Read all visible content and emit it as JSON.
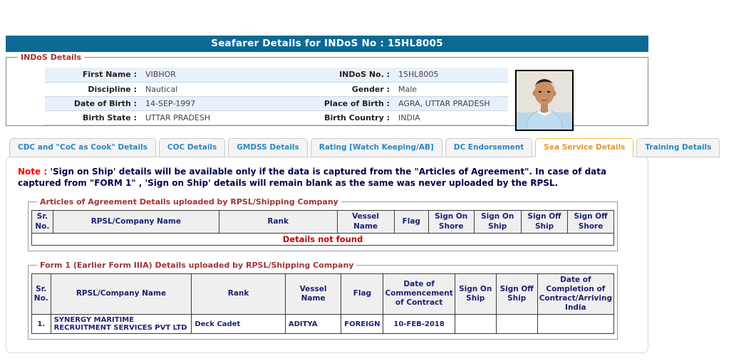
{
  "page": {
    "title": "Seafarer Details for INDoS No : 15HL8005"
  },
  "indos": {
    "legend": "INDoS Details",
    "rows": [
      {
        "l1": "First Name :",
        "v1": "VIBHOR",
        "l2": "INDoS No. :",
        "v2": "15HL8005"
      },
      {
        "l1": "Discipline :",
        "v1": "Nautical",
        "l2": "Gender :",
        "v2": "Male"
      },
      {
        "l1": "Date of Birth :",
        "v1": "14-SEP-1997",
        "l2": "Place of Birth :",
        "v2": "AGRA, UTTAR PRADESH"
      },
      {
        "l1": "Birth State :",
        "v1": "UTTAR PRADESH",
        "l2": "Birth Country :",
        "v2": "INDIA"
      }
    ]
  },
  "tabs": [
    {
      "label": "CDC and \"CoC as Cook\" Details",
      "active": false
    },
    {
      "label": "COC Details",
      "active": false
    },
    {
      "label": "GMDSS Details",
      "active": false
    },
    {
      "label": "Rating [Watch Keeping/AB]",
      "active": false
    },
    {
      "label": "DC Endorsement",
      "active": false
    },
    {
      "label": "Sea Service Details",
      "active": true
    },
    {
      "label": "Training Details",
      "active": false
    }
  ],
  "note": {
    "prefix": "Note :",
    "text": "'Sign on Ship' details will be available only if the data is captured from the \"Articles of Agreement\". In case of data captured from \"FORM 1\" , 'Sign on Ship' details will remain blank as the same was never uploaded by the RPSL."
  },
  "articles": {
    "legend": "Articles of Agreement Details uploaded by RPSL/Shipping Company",
    "columns": [
      "Sr. No.",
      "RPSL/Company Name",
      "Rank",
      "Vessel Name",
      "Flag",
      "Sign On Shore",
      "Sign On Ship",
      "Sign Off Ship",
      "Sign Off Shore"
    ],
    "empty_message": "Details not found"
  },
  "form1": {
    "legend": "Form 1 (Earlier Form IIIA) Details uploaded by RPSL/Shipping Company",
    "columns": [
      "Sr. No.",
      "RPSL/Company Name",
      "Rank",
      "Vessel Name",
      "Flag",
      "Date of Commencement of Contract",
      "Sign On Ship",
      "Sign Off Ship",
      "Date of Completion of Contract/Arriving India"
    ],
    "rows": [
      {
        "sr": "1.",
        "company": "SYNERGY MARITIME RECRUITMENT SERVICES PVT LTD",
        "rank": "Deck Cadet",
        "vessel": "ADITYA",
        "flag": "FOREIGN",
        "commencement": "10-FEB-2018",
        "sign_on_ship": "",
        "sign_off_ship": "",
        "completion": ""
      }
    ]
  },
  "colors": {
    "titlebar_bg": "#0D6A94",
    "row_stripe": "#E8F1FA",
    "tab_text": "#2B87C3",
    "active_tab_text": "#E9952F",
    "active_tab_border": "#F3C13E",
    "legend_red": "#A23333",
    "note_navy": "#00004D",
    "note_red": "#FF0000",
    "table_text_navy": "#1C2274",
    "empty_red": "#C00000"
  }
}
